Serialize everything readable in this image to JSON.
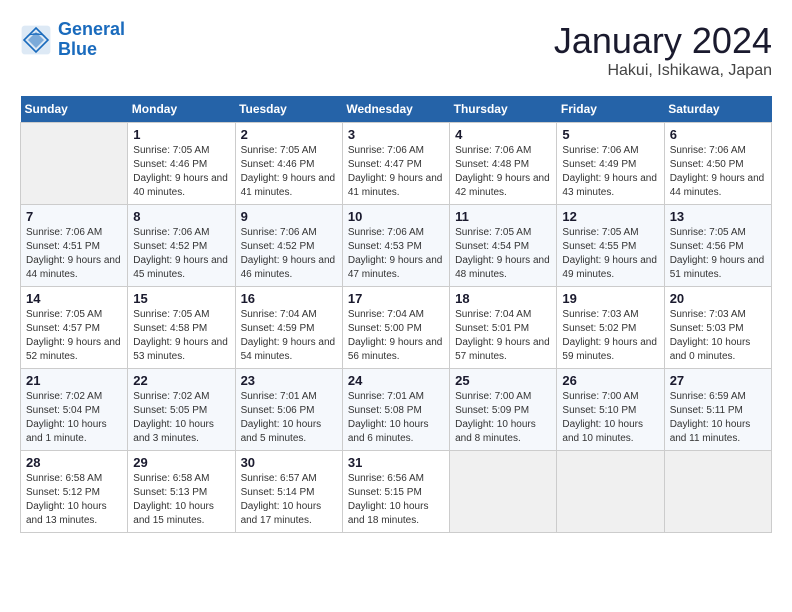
{
  "logo": {
    "line1": "General",
    "line2": "Blue"
  },
  "title": "January 2024",
  "location": "Hakui, Ishikawa, Japan",
  "days_header": [
    "Sunday",
    "Monday",
    "Tuesday",
    "Wednesday",
    "Thursday",
    "Friday",
    "Saturday"
  ],
  "weeks": [
    [
      {
        "num": "",
        "sunrise": "",
        "sunset": "",
        "daylight": ""
      },
      {
        "num": "1",
        "sunrise": "Sunrise: 7:05 AM",
        "sunset": "Sunset: 4:46 PM",
        "daylight": "Daylight: 9 hours and 40 minutes."
      },
      {
        "num": "2",
        "sunrise": "Sunrise: 7:05 AM",
        "sunset": "Sunset: 4:46 PM",
        "daylight": "Daylight: 9 hours and 41 minutes."
      },
      {
        "num": "3",
        "sunrise": "Sunrise: 7:06 AM",
        "sunset": "Sunset: 4:47 PM",
        "daylight": "Daylight: 9 hours and 41 minutes."
      },
      {
        "num": "4",
        "sunrise": "Sunrise: 7:06 AM",
        "sunset": "Sunset: 4:48 PM",
        "daylight": "Daylight: 9 hours and 42 minutes."
      },
      {
        "num": "5",
        "sunrise": "Sunrise: 7:06 AM",
        "sunset": "Sunset: 4:49 PM",
        "daylight": "Daylight: 9 hours and 43 minutes."
      },
      {
        "num": "6",
        "sunrise": "Sunrise: 7:06 AM",
        "sunset": "Sunset: 4:50 PM",
        "daylight": "Daylight: 9 hours and 44 minutes."
      }
    ],
    [
      {
        "num": "7",
        "sunrise": "Sunrise: 7:06 AM",
        "sunset": "Sunset: 4:51 PM",
        "daylight": "Daylight: 9 hours and 44 minutes."
      },
      {
        "num": "8",
        "sunrise": "Sunrise: 7:06 AM",
        "sunset": "Sunset: 4:52 PM",
        "daylight": "Daylight: 9 hours and 45 minutes."
      },
      {
        "num": "9",
        "sunrise": "Sunrise: 7:06 AM",
        "sunset": "Sunset: 4:52 PM",
        "daylight": "Daylight: 9 hours and 46 minutes."
      },
      {
        "num": "10",
        "sunrise": "Sunrise: 7:06 AM",
        "sunset": "Sunset: 4:53 PM",
        "daylight": "Daylight: 9 hours and 47 minutes."
      },
      {
        "num": "11",
        "sunrise": "Sunrise: 7:05 AM",
        "sunset": "Sunset: 4:54 PM",
        "daylight": "Daylight: 9 hours and 48 minutes."
      },
      {
        "num": "12",
        "sunrise": "Sunrise: 7:05 AM",
        "sunset": "Sunset: 4:55 PM",
        "daylight": "Daylight: 9 hours and 49 minutes."
      },
      {
        "num": "13",
        "sunrise": "Sunrise: 7:05 AM",
        "sunset": "Sunset: 4:56 PM",
        "daylight": "Daylight: 9 hours and 51 minutes."
      }
    ],
    [
      {
        "num": "14",
        "sunrise": "Sunrise: 7:05 AM",
        "sunset": "Sunset: 4:57 PM",
        "daylight": "Daylight: 9 hours and 52 minutes."
      },
      {
        "num": "15",
        "sunrise": "Sunrise: 7:05 AM",
        "sunset": "Sunset: 4:58 PM",
        "daylight": "Daylight: 9 hours and 53 minutes."
      },
      {
        "num": "16",
        "sunrise": "Sunrise: 7:04 AM",
        "sunset": "Sunset: 4:59 PM",
        "daylight": "Daylight: 9 hours and 54 minutes."
      },
      {
        "num": "17",
        "sunrise": "Sunrise: 7:04 AM",
        "sunset": "Sunset: 5:00 PM",
        "daylight": "Daylight: 9 hours and 56 minutes."
      },
      {
        "num": "18",
        "sunrise": "Sunrise: 7:04 AM",
        "sunset": "Sunset: 5:01 PM",
        "daylight": "Daylight: 9 hours and 57 minutes."
      },
      {
        "num": "19",
        "sunrise": "Sunrise: 7:03 AM",
        "sunset": "Sunset: 5:02 PM",
        "daylight": "Daylight: 9 hours and 59 minutes."
      },
      {
        "num": "20",
        "sunrise": "Sunrise: 7:03 AM",
        "sunset": "Sunset: 5:03 PM",
        "daylight": "Daylight: 10 hours and 0 minutes."
      }
    ],
    [
      {
        "num": "21",
        "sunrise": "Sunrise: 7:02 AM",
        "sunset": "Sunset: 5:04 PM",
        "daylight": "Daylight: 10 hours and 1 minute."
      },
      {
        "num": "22",
        "sunrise": "Sunrise: 7:02 AM",
        "sunset": "Sunset: 5:05 PM",
        "daylight": "Daylight: 10 hours and 3 minutes."
      },
      {
        "num": "23",
        "sunrise": "Sunrise: 7:01 AM",
        "sunset": "Sunset: 5:06 PM",
        "daylight": "Daylight: 10 hours and 5 minutes."
      },
      {
        "num": "24",
        "sunrise": "Sunrise: 7:01 AM",
        "sunset": "Sunset: 5:08 PM",
        "daylight": "Daylight: 10 hours and 6 minutes."
      },
      {
        "num": "25",
        "sunrise": "Sunrise: 7:00 AM",
        "sunset": "Sunset: 5:09 PM",
        "daylight": "Daylight: 10 hours and 8 minutes."
      },
      {
        "num": "26",
        "sunrise": "Sunrise: 7:00 AM",
        "sunset": "Sunset: 5:10 PM",
        "daylight": "Daylight: 10 hours and 10 minutes."
      },
      {
        "num": "27",
        "sunrise": "Sunrise: 6:59 AM",
        "sunset": "Sunset: 5:11 PM",
        "daylight": "Daylight: 10 hours and 11 minutes."
      }
    ],
    [
      {
        "num": "28",
        "sunrise": "Sunrise: 6:58 AM",
        "sunset": "Sunset: 5:12 PM",
        "daylight": "Daylight: 10 hours and 13 minutes."
      },
      {
        "num": "29",
        "sunrise": "Sunrise: 6:58 AM",
        "sunset": "Sunset: 5:13 PM",
        "daylight": "Daylight: 10 hours and 15 minutes."
      },
      {
        "num": "30",
        "sunrise": "Sunrise: 6:57 AM",
        "sunset": "Sunset: 5:14 PM",
        "daylight": "Daylight: 10 hours and 17 minutes."
      },
      {
        "num": "31",
        "sunrise": "Sunrise: 6:56 AM",
        "sunset": "Sunset: 5:15 PM",
        "daylight": "Daylight: 10 hours and 18 minutes."
      },
      {
        "num": "",
        "sunrise": "",
        "sunset": "",
        "daylight": ""
      },
      {
        "num": "",
        "sunrise": "",
        "sunset": "",
        "daylight": ""
      },
      {
        "num": "",
        "sunrise": "",
        "sunset": "",
        "daylight": ""
      }
    ]
  ]
}
